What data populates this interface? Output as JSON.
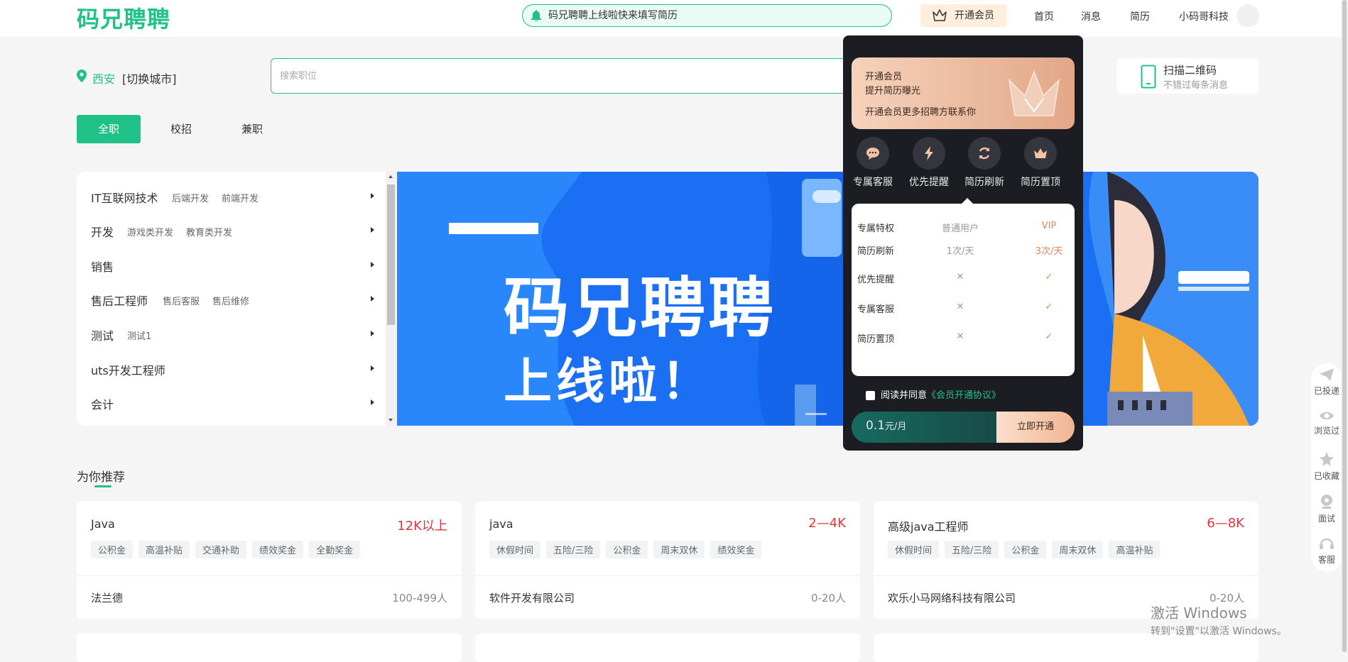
{
  "header": {
    "logo": "码兄聘聘",
    "notice": "码兄聘聘上线啦快来填写简历",
    "vip_button": "开通会员",
    "nav": [
      "首页",
      "消息",
      "简历",
      "小码哥科技"
    ]
  },
  "location": {
    "city": "西安",
    "switch": "[切换城市]"
  },
  "search": {
    "placeholder": "搜索职位"
  },
  "qr": {
    "title": "扫描二维码",
    "subtitle": "不错过每条消息"
  },
  "tabs": [
    "全职",
    "校招",
    "兼职"
  ],
  "categories": [
    {
      "name": "IT互联网技术",
      "subs": [
        "后端开发",
        "前端开发"
      ]
    },
    {
      "name": "开发",
      "subs": [
        "游戏类开发",
        "教育类开发"
      ]
    },
    {
      "name": "销售",
      "subs": []
    },
    {
      "name": "售后工程师",
      "subs": [
        "售后客服",
        "售后维修"
      ]
    },
    {
      "name": "测试",
      "subs": [
        "测试1"
      ]
    },
    {
      "name": "uts开发工程师",
      "subs": []
    },
    {
      "name": "会计",
      "subs": []
    }
  ],
  "banner": {
    "line1": "码兄聘聘",
    "line2": "上线啦！"
  },
  "recommend": {
    "title": "为你推荐",
    "jobs": [
      {
        "title": "Java",
        "salary": "12K以上",
        "tags": [
          "公积金",
          "高温补贴",
          "交通补助",
          "绩效奖金",
          "全勤奖金"
        ],
        "company": "法兰德",
        "size": "100-499人"
      },
      {
        "title": "java",
        "salary": "2—4K",
        "tags": [
          "休假时间",
          "五险/三险",
          "公积金",
          "周末双休",
          "绩效奖金"
        ],
        "company": "软件开发有限公司",
        "size": "0-20人"
      },
      {
        "title": "高级java工程师",
        "salary": "6—8K",
        "tags": [
          "休假时间",
          "五险/三险",
          "公积金",
          "周末双休",
          "高温补贴"
        ],
        "company": "欢乐小马网络科技有限公司",
        "size": "0-20人"
      }
    ]
  },
  "vip_popup": {
    "banner": {
      "line1": "开通会员",
      "line2": "提升简历曝光",
      "line3": "开通会员更多招聘方联系你"
    },
    "perks": [
      {
        "label": "专属客服",
        "icon": "chat-icon"
      },
      {
        "label": "优先提醒",
        "icon": "lightning-icon"
      },
      {
        "label": "简历刷新",
        "icon": "refresh-icon"
      },
      {
        "label": "简历置顶",
        "icon": "crown-icon"
      }
    ],
    "comparison": {
      "header": [
        "专属特权",
        "普通用户",
        "VIP"
      ],
      "rows": [
        {
          "name": "简历刷新",
          "normal": "1次/天",
          "vip": "3次/天"
        },
        {
          "name": "优先提醒",
          "normal": "✕",
          "vip": "✓"
        },
        {
          "name": "专属客服",
          "normal": "✕",
          "vip": "✓"
        },
        {
          "name": "简历置顶",
          "normal": "✕",
          "vip": "✓"
        }
      ]
    },
    "agree_text": "阅读并同意",
    "agree_link": "《会员开通协议》",
    "price": "0.1",
    "price_unit": "元/月",
    "buy": "立即开通"
  },
  "float_bar": [
    "已投递",
    "浏览过",
    "已收藏",
    "面试",
    "客服"
  ],
  "watermark": {
    "line1": "激活 Windows",
    "line2": "转到\"设置\"以激活 Windows。"
  },
  "colors": {
    "brand": "#1fc189",
    "salary": "#e0333b",
    "vip_accent": "#e08a58"
  }
}
